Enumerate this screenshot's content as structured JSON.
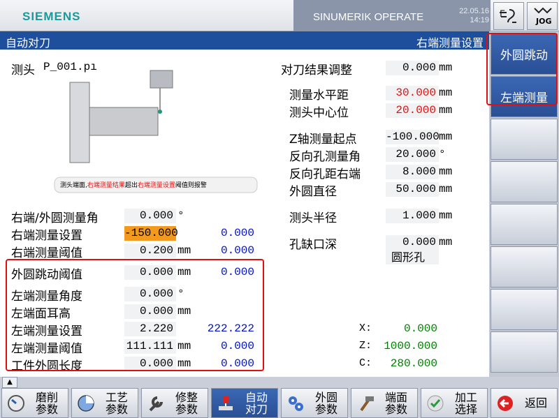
{
  "header": {
    "brand": "SIEMENS",
    "product": "SINUMERIK OPERATE",
    "date": "22.05.16",
    "time": "14:19",
    "jog_label": "JOG"
  },
  "titlebar": {
    "left": "自动对刀",
    "right": "右端测量设置"
  },
  "probe": {
    "label": "测头",
    "value": "P_001.pı",
    "caption_pre": "测头端面,",
    "caption_red1": "右端测量结果",
    "caption_mid": "超出",
    "caption_red2": "右端测量设置",
    "caption_post": "阈值则报警"
  },
  "right_fields": [
    {
      "label": "对刀结果调整",
      "value": "0.000",
      "unit": "mm",
      "color": "#000"
    },
    {
      "label": "测量水平距",
      "value": "30.000",
      "unit": "mm",
      "color": "#e01010"
    },
    {
      "label": "测头中心位",
      "value": "20.000",
      "unit": "mm",
      "color": "#e01010"
    },
    {
      "label": "Z轴测量起点",
      "value": "-100.000",
      "unit": "mm",
      "color": "#000"
    },
    {
      "label": "反向孔测量角",
      "value": "20.000",
      "unit": "°",
      "color": "#000"
    },
    {
      "label": "反向孔距右端",
      "value": "8.000",
      "unit": "mm",
      "color": "#000"
    },
    {
      "label": "外圆直径",
      "value": "50.000",
      "unit": "mm",
      "color": "#000"
    },
    {
      "label": "测头半径",
      "value": "1.000",
      "unit": "mm",
      "color": "#000"
    },
    {
      "label": "孔缺口深",
      "value": "0.000",
      "unit": "mm",
      "color": "#000"
    }
  ],
  "hole_type": "圆形孔",
  "left_fields": [
    {
      "label": "右端/外圆测量角",
      "value": "0.000",
      "unit": "°",
      "extra": ""
    },
    {
      "label": "右端测量设置",
      "value": "-150.000",
      "unit": "",
      "extra": "0.000",
      "highlight": true
    },
    {
      "label": "右端测量阈值",
      "value": "0.200",
      "unit": "mm",
      "extra": "0.000"
    },
    {
      "label": "外圆跳动阈值",
      "value": "0.000",
      "unit": "mm",
      "extra": "0.000"
    },
    {
      "label": "左端测量角度",
      "value": "0.000",
      "unit": "°",
      "extra": ""
    },
    {
      "label": "左端面耳高",
      "value": "0.000",
      "unit": "mm",
      "extra": ""
    },
    {
      "label": "左端测量设置",
      "value": "2.220",
      "unit": "",
      "extra": "222.222"
    },
    {
      "label": "左端测量阈值",
      "value": "111.111",
      "unit": "mm",
      "extra": "0.000"
    },
    {
      "label": "工件外圆长度",
      "value": "0.000",
      "unit": "mm",
      "extra": "0.000"
    }
  ],
  "coords": [
    {
      "axis": "X:",
      "value": "0.000"
    },
    {
      "axis": "Z:",
      "value": "1000.000"
    },
    {
      "axis": "C:",
      "value": "280.000"
    }
  ],
  "softkeys": [
    {
      "label": "外圆跳动"
    },
    {
      "label": "左端测量"
    },
    {
      "label": ""
    },
    {
      "label": ""
    },
    {
      "label": ""
    },
    {
      "label": ""
    },
    {
      "label": ""
    },
    {
      "label": ""
    }
  ],
  "bottom_keys": [
    {
      "l1": "磨削",
      "l2": "参数",
      "icon": "dial-icon"
    },
    {
      "l1": "工艺",
      "l2": "参数",
      "icon": "pie-icon"
    },
    {
      "l1": "修整",
      "l2": "参数",
      "icon": "wrench-icon"
    },
    {
      "l1": "自动",
      "l2": "对刀",
      "icon": "probe-icon",
      "active": true
    },
    {
      "l1": "外圆",
      "l2": "参数",
      "icon": "gears-icon"
    },
    {
      "l1": "端面",
      "l2": "参数",
      "icon": "hammer-icon"
    },
    {
      "l1": "加工",
      "l2": "选择",
      "icon": "check-icon"
    },
    {
      "l1": "返回",
      "l2": "",
      "icon": "back-icon"
    }
  ]
}
